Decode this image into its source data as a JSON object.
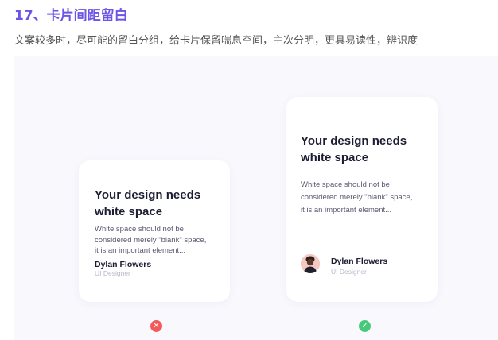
{
  "heading": "17、卡片间距留白",
  "subtitle": "文案较多时，尽可能的留白分组，给卡片保留喘息空间，主次分明，更具易读性，辨识度",
  "cards": {
    "bad": {
      "title_line1": "Your design needs",
      "title_line2": "white space",
      "body_line1": "White space should not be",
      "body_line2": "considered merely \"blank\" space,",
      "body_line3": "it is an important element...",
      "author": "Dylan Flowers",
      "role": "UI Designer",
      "mark_icon": "close-icon",
      "mark_glyph": "✕"
    },
    "good": {
      "title_line1": "Your design needs",
      "title_line2": "white space",
      "body_line1": "White space should not be",
      "body_line2": "considered merely \"blank\" space,",
      "body_line3": "it is an important element...",
      "author": "Dylan Flowers",
      "role": "UI Designer",
      "avatar_icon": "avatar-icon",
      "mark_icon": "check-icon",
      "mark_glyph": "✓"
    }
  },
  "colors": {
    "heading": "#6b55e6",
    "panel_bg": "#f8f8fd",
    "bad": "#f25a5a",
    "good": "#46c97a"
  }
}
